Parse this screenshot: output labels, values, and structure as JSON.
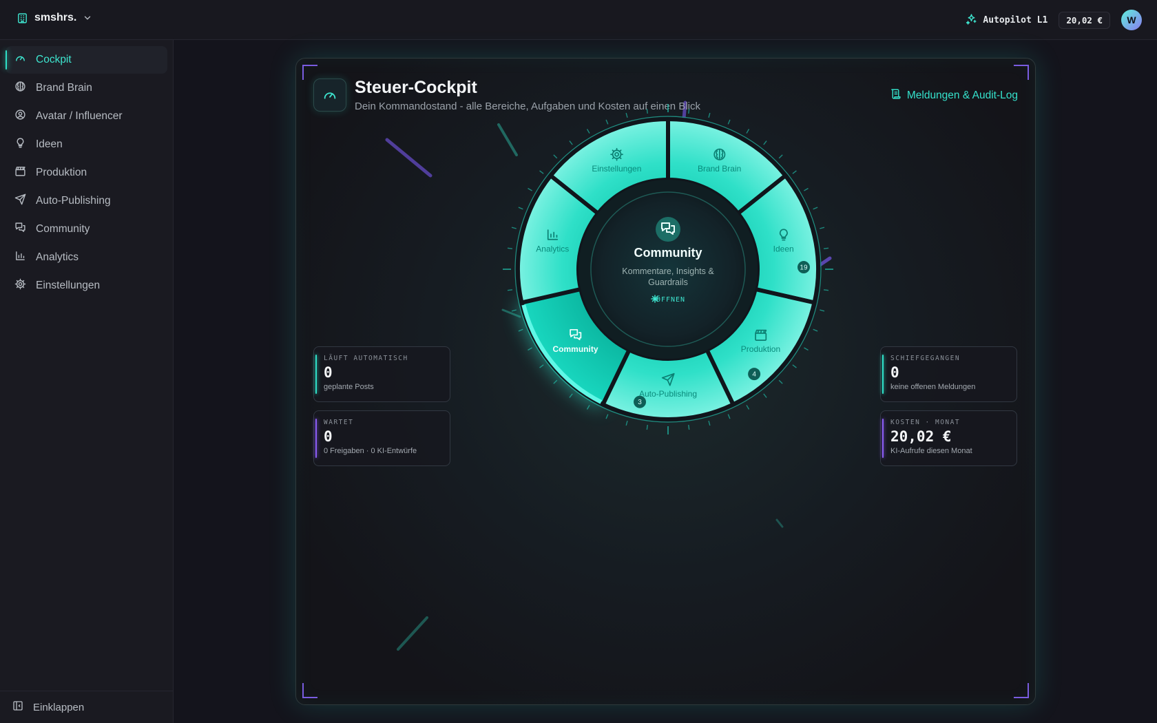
{
  "workspace": {
    "name": "smshrs."
  },
  "topbar": {
    "autopilot_label": "Autopilot L1",
    "cost": "20,02 €",
    "avatar_initial": "W"
  },
  "sidebar": {
    "items": [
      {
        "label": "Cockpit",
        "icon": "gauge-icon",
        "active": true
      },
      {
        "label": "Brand Brain",
        "icon": "brain-icon"
      },
      {
        "label": "Avatar / Influencer",
        "icon": "user-circle-icon"
      },
      {
        "label": "Ideen",
        "icon": "lightbulb-icon"
      },
      {
        "label": "Produktion",
        "icon": "clapperboard-icon"
      },
      {
        "label": "Auto-Publishing",
        "icon": "send-icon"
      },
      {
        "label": "Community",
        "icon": "chat-icon"
      },
      {
        "label": "Analytics",
        "icon": "bar-chart-icon"
      },
      {
        "label": "Einstellungen",
        "icon": "gear-icon"
      }
    ],
    "collapse_label": "Einklappen"
  },
  "header": {
    "title": "Steuer-Cockpit",
    "subtitle": "Dein Kommandostand - alle Bereiche, Aufgaben und Kosten auf einen Blick",
    "audit_link": "Meldungen & Audit-Log"
  },
  "stats": {
    "auto": {
      "label": "LÄUFT AUTOMATISCH",
      "value": "0",
      "note": "geplante Posts"
    },
    "waiting": {
      "label": "WARTET",
      "value": "0",
      "note": "0 Freigaben · 0 KI-Entwürfe"
    },
    "failed": {
      "label": "SCHIEFGEGANGEN",
      "value": "0",
      "note": "keine offenen Meldungen"
    },
    "costs": {
      "label": "KOSTEN · MONAT",
      "value": "20,02 €",
      "note": "KI-Aufrufe diesen Monat"
    }
  },
  "wheel": {
    "segments": [
      {
        "label": "Brand Brain",
        "icon": "brain-icon",
        "badge": ""
      },
      {
        "label": "Ideen",
        "icon": "lightbulb-icon",
        "badge": "19"
      },
      {
        "label": "Produktion",
        "icon": "clapperboard-icon",
        "badge": "4"
      },
      {
        "label": "Auto-Publishing",
        "icon": "send-icon",
        "badge": "3"
      },
      {
        "label": "Community",
        "icon": "chat-icon",
        "badge": "",
        "selected": true
      },
      {
        "label": "Analytics",
        "icon": "bar-chart-icon",
        "badge": ""
      },
      {
        "label": "Einstellungen",
        "icon": "gear-icon",
        "badge": ""
      }
    ],
    "center": {
      "title": "Community",
      "description": "Kommentare, Insights & Guardrails",
      "open_label": "ÖFFNEN"
    }
  },
  "colors": {
    "accent": "#2fe0c8",
    "violet": "#8b5cf6",
    "background": "#14141c"
  }
}
